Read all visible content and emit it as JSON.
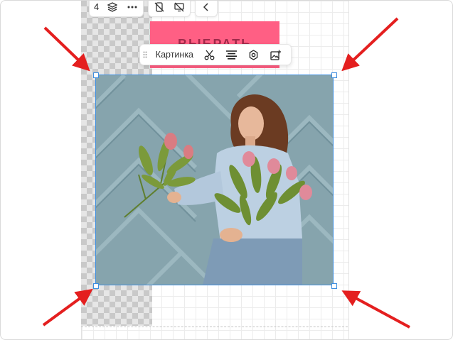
{
  "top_toolbar": {
    "layer_count": "4",
    "icons": [
      "layers-icon",
      "more-icon",
      "hide-mobile-icon",
      "hide-desktop-icon",
      "collapse-icon"
    ]
  },
  "banner": {
    "text": "ВЫБРАТЬ",
    "color": "#ff5f84"
  },
  "selection_toolbar": {
    "label": "Картинка",
    "actions": [
      "crop-icon",
      "align-icon",
      "settings-icon",
      "replace-image-icon"
    ]
  },
  "colors": {
    "accent": "#3f8fe0",
    "arrow": "#e41f1f",
    "banner": "#ff5f84"
  }
}
